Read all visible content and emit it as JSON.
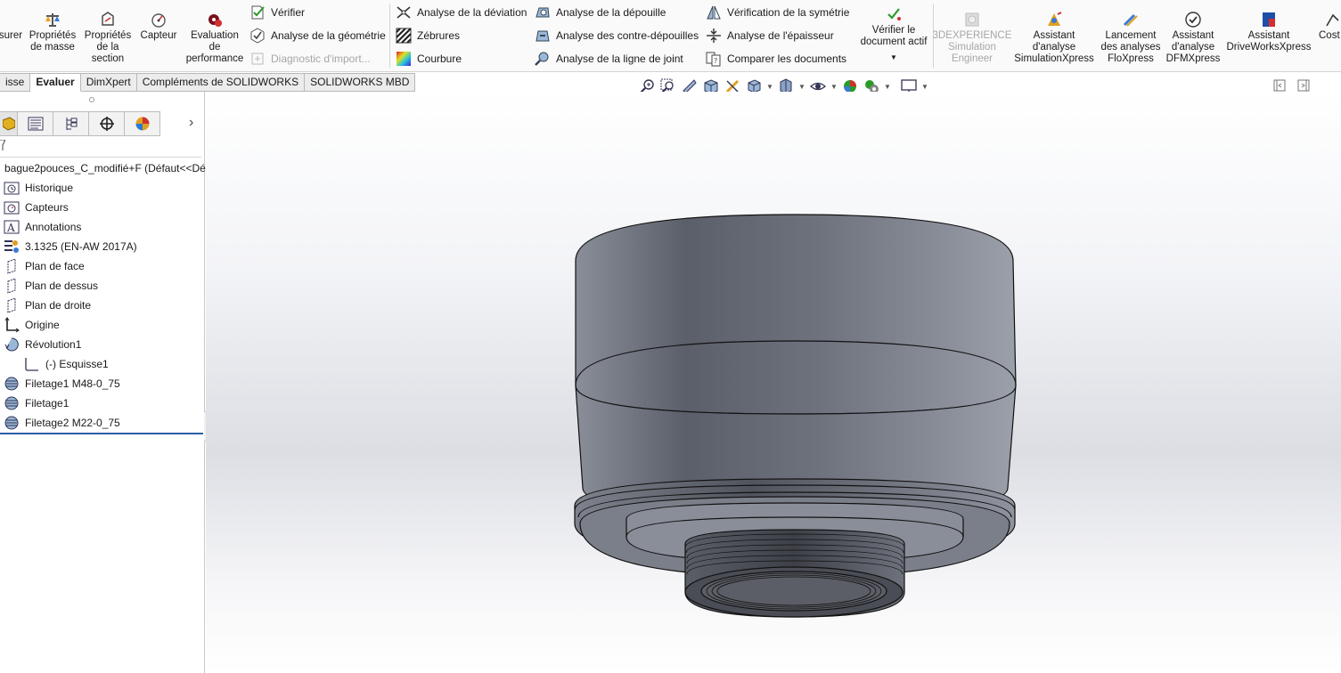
{
  "ribbon": {
    "mesurer_label": "surer",
    "mass_props_label": "Propriétés\nde masse",
    "section_props_label": "Propriétés\nde la\nsection",
    "sensor_label": "Capteur",
    "performance_label": "Evaluation\nde\nperformance",
    "verify_label": "Vérifier",
    "geometry_label": "Analyse de la géométrie",
    "import_diag_label": "Diagnostic d'import...",
    "deviation_label": "Analyse de la déviation",
    "zebra_label": "Zébrures",
    "curvature_label": "Courbure",
    "draft_label": "Analyse de la dépouille",
    "undercut_label": "Analyse des contre-dépouilles",
    "parting_label": "Analyse de la ligne de joint",
    "symmetry_label": "Vérification de la symétrie",
    "thickness_label": "Analyse de l'épaisseur",
    "compare_label": "Comparer les documents",
    "check_active_label": "Vérifier le\ndocument actif",
    "simulation_engineer_label": "3DEXPERIENCE\nSimulation\nEngineer",
    "simxpress_label": "Assistant\nd'analyse\nSimulationXpress",
    "floxpress_label": "Lancement\ndes analyses\nFloXpress",
    "dfmxpress_label": "Assistant\nd'analyse\nDFMXpress",
    "driveworks_label": "Assistant\nDriveWorksXpress",
    "costing_label": "Cost"
  },
  "tabs": [
    "isse",
    "Evaluer",
    "DimXpert",
    "Compléments de SOLIDWORKS",
    "SOLIDWORKS MBD"
  ],
  "active_tab": "Evaluer",
  "tree": {
    "root": "bague2pouces_C_modifié+F  (Défaut<<Dé",
    "items": [
      "Historique",
      "Capteurs",
      "Annotations",
      "3.1325 (EN-AW 2017A)",
      "Plan de face",
      "Plan de dessus",
      "Plan de droite",
      "Origine",
      "Révolution1",
      "(-) Esquisse1",
      "Filetage1 M48-0_75",
      "Filetage1",
      "Filetage2 M22-0_75"
    ]
  },
  "icons": {
    "ribbon": [
      "scale-icon",
      "section-icon",
      "gauge-icon",
      "performance-icon",
      "verify-icon",
      "geometry-check-icon",
      "import-diagnostic-icon",
      "deviation-icon",
      "zebra-icon",
      "curvature-icon",
      "draft-icon",
      "undercut-icon",
      "parting-line-icon",
      "symmetry-icon",
      "thickness-icon",
      "compare-icon",
      "check-document-icon",
      "simulation-engineer-icon",
      "simulationxpress-icon",
      "floxpress-icon",
      "dfmxpress-icon",
      "driveworks-icon"
    ],
    "heads_up": [
      "zoom-fit-icon",
      "zoom-area-icon",
      "previous-view-icon",
      "section-view-icon",
      "dynamic-annotation-icon",
      "view-orientation-icon",
      "display-style-icon",
      "hide-show-icon",
      "appearance-icon",
      "scene-icon",
      "display-settings-icon"
    ]
  },
  "colors": {
    "part_body": "#6c717c",
    "part_dark": "#3f434b",
    "rollback_bar": "#2c5fa8",
    "viewport_mid": "#dcdee4"
  }
}
